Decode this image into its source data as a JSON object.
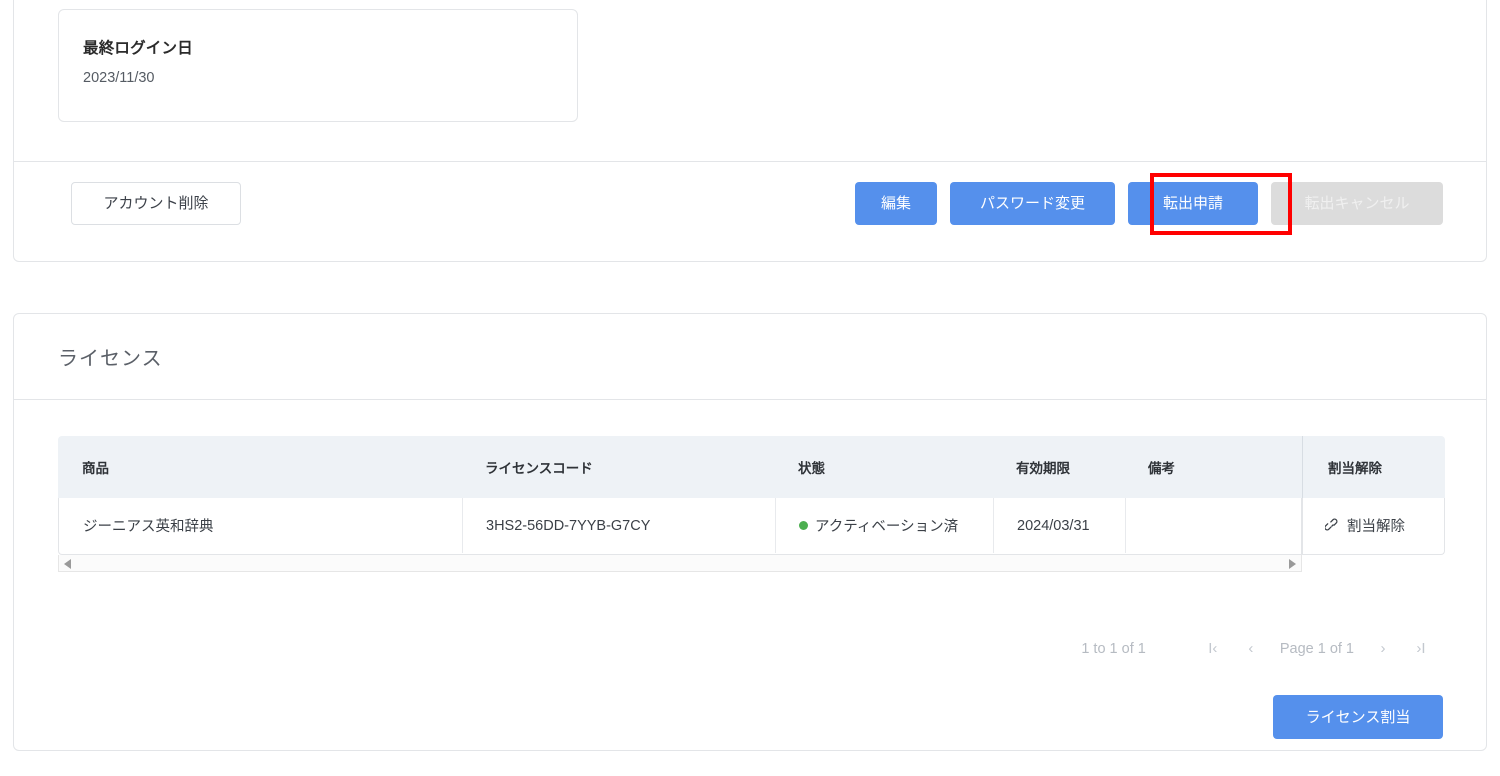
{
  "account_card": {
    "info_box": {
      "label": "最終ログイン日",
      "value": "2023/11/30"
    },
    "delete_account_label": "アカウント削除",
    "actions": {
      "edit_label": "編集",
      "change_password_label": "パスワード変更",
      "transfer_apply_label": "転出申請",
      "transfer_cancel_label": "転出キャンセル"
    },
    "highlight_color": "#ff0000",
    "primary_color": "#5590ec",
    "disabled_color": "#dcdcdc"
  },
  "license_card": {
    "title": "ライセンス",
    "grid": {
      "columns": [
        {
          "key": "product",
          "label": "商品"
        },
        {
          "key": "code",
          "label": "ライセンスコード"
        },
        {
          "key": "status",
          "label": "状態"
        },
        {
          "key": "expiry",
          "label": "有効期限"
        },
        {
          "key": "remarks",
          "label": "備考"
        }
      ],
      "pinned_column": {
        "key": "unassign",
        "label": "割当解除"
      },
      "rows": [
        {
          "product": "ジーニアス英和辞典",
          "code": "3HS2-56DD-7YYB-G7CY",
          "status": "アクティベーション済",
          "status_color": "#4caf50",
          "expiry": "2024/03/31",
          "remarks": "",
          "unassign_label": "割当解除",
          "unassign_icon": "broken-link-icon"
        }
      ]
    },
    "scrollbars": {
      "left_arrow_icon": "triangle-left-icon",
      "right_arrow_icon": "triangle-right-icon"
    },
    "pagination": {
      "summary": "1 to 1 of 1",
      "first_label": "I‹",
      "prev_label": "‹",
      "page_label": "Page 1 of 1",
      "next_label": "›",
      "last_label": "›I"
    },
    "assign_license_label": "ライセンス割当"
  }
}
